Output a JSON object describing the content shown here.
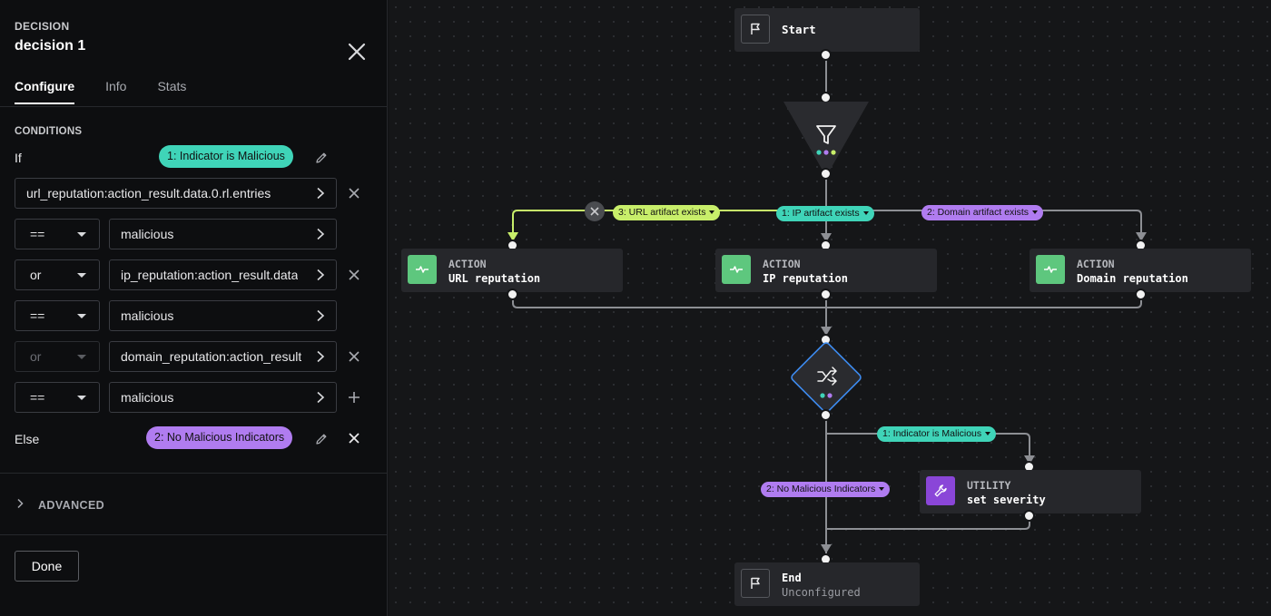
{
  "panel": {
    "kicker": "DECISION",
    "title": "decision 1",
    "tabs": [
      "Configure",
      "Info",
      "Stats"
    ],
    "conditions_label": "CONDITIONS",
    "if_label": "If",
    "if_outcome": "1: Indicator is Malicious",
    "rows": [
      {
        "operator": "",
        "field": "url_reputation:action_result.data.0.rl.entries",
        "removable": true
      },
      {
        "operator": "==",
        "field": "malicious"
      },
      {
        "operator": "or",
        "field": "ip_reputation:action_result.data",
        "removable": true
      },
      {
        "operator": "==",
        "field": "malicious"
      },
      {
        "operator": "or",
        "field": "domain_reputation:action_result",
        "removable": true,
        "disabled": true
      },
      {
        "operator": "==",
        "field": "malicious",
        "addable": true
      }
    ],
    "else_label": "Else",
    "else_outcome": "2: No Malicious Indicators",
    "advanced_label": "ADVANCED",
    "done_label": "Done"
  },
  "canvas": {
    "start": {
      "label": "Start"
    },
    "actions": [
      {
        "kind": "ACTION",
        "name": "URL reputation"
      },
      {
        "kind": "ACTION",
        "name": "IP reputation"
      },
      {
        "kind": "ACTION",
        "name": "Domain reputation"
      }
    ],
    "edge_labels": {
      "url": "3: URL artifact exists",
      "ip": "1: IP artifact exists",
      "domain": "2: Domain artifact exists",
      "malicious": "1: Indicator is Malicious",
      "no_malicious": "2: No Malicious Indicators"
    },
    "utility": {
      "kind": "UTILITY",
      "name": "set severity"
    },
    "end": {
      "label": "End",
      "status": "Unconfigured"
    }
  },
  "colors": {
    "teal": "#3fd4b8",
    "purple": "#b07cf0",
    "lime": "#c8ee6a",
    "action_green": "#5ec77e",
    "utility_violet": "#8a46d8",
    "decision_blue": "#3d8bf0"
  }
}
